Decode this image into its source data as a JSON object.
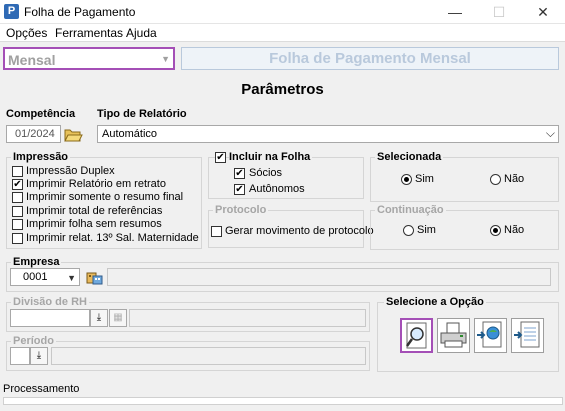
{
  "window": {
    "title": "Folha de Pagamento",
    "app_icon_letter": "P",
    "minimize": "—",
    "maximize": "☐",
    "close": "✕"
  },
  "menu": [
    "Opções",
    "Ferramentas",
    "Ajuda"
  ],
  "header": {
    "mode_value": "Mensal",
    "report_title": "Folha de Pagamento Mensal"
  },
  "params_title": "Parâmetros",
  "competencia": {
    "label": "Competência",
    "value": "01/2024"
  },
  "tipo_relatorio": {
    "label": "Tipo de Relatório",
    "value": "Automático"
  },
  "impressao": {
    "title": "Impressão",
    "options": [
      {
        "label": "Impressão Duplex",
        "checked": false
      },
      {
        "label": "Imprimir Relatório em retrato",
        "checked": true
      },
      {
        "label": "Imprimir somente o resumo final",
        "checked": false
      },
      {
        "label": "Imprimir total de referências",
        "checked": false
      },
      {
        "label": "Imprimir folha sem resumos",
        "checked": false
      },
      {
        "label": "Imprimir relat. 13º Sal. Maternidade",
        "checked": false
      }
    ]
  },
  "incluir": {
    "title": "Incluir na Folha",
    "checked": true,
    "options": [
      {
        "label": "Sócios",
        "checked": true
      },
      {
        "label": "Autônomos",
        "checked": true
      }
    ]
  },
  "protocolo": {
    "title": "Protocolo",
    "option": {
      "label": "Gerar movimento de protocolo",
      "checked": false
    }
  },
  "selecionada": {
    "title": "Selecionada",
    "options": [
      {
        "label": "Sim",
        "selected": true
      },
      {
        "label": "Não",
        "selected": false
      }
    ]
  },
  "continuacao": {
    "title": "Continuação",
    "options": [
      {
        "label": "Sim",
        "selected": false
      },
      {
        "label": "Não",
        "selected": true
      }
    ]
  },
  "empresa": {
    "label": "Empresa",
    "value": "0001",
    "name": ""
  },
  "divisao": {
    "label": "Divisão de RH",
    "value": ""
  },
  "periodo": {
    "label": "Período",
    "value": ""
  },
  "selecione": {
    "title": "Selecione a Opção"
  },
  "status": {
    "text": "Processamento"
  },
  "colors": {
    "accent": "#a44fb6",
    "title_blue": "#b9c9dc"
  }
}
